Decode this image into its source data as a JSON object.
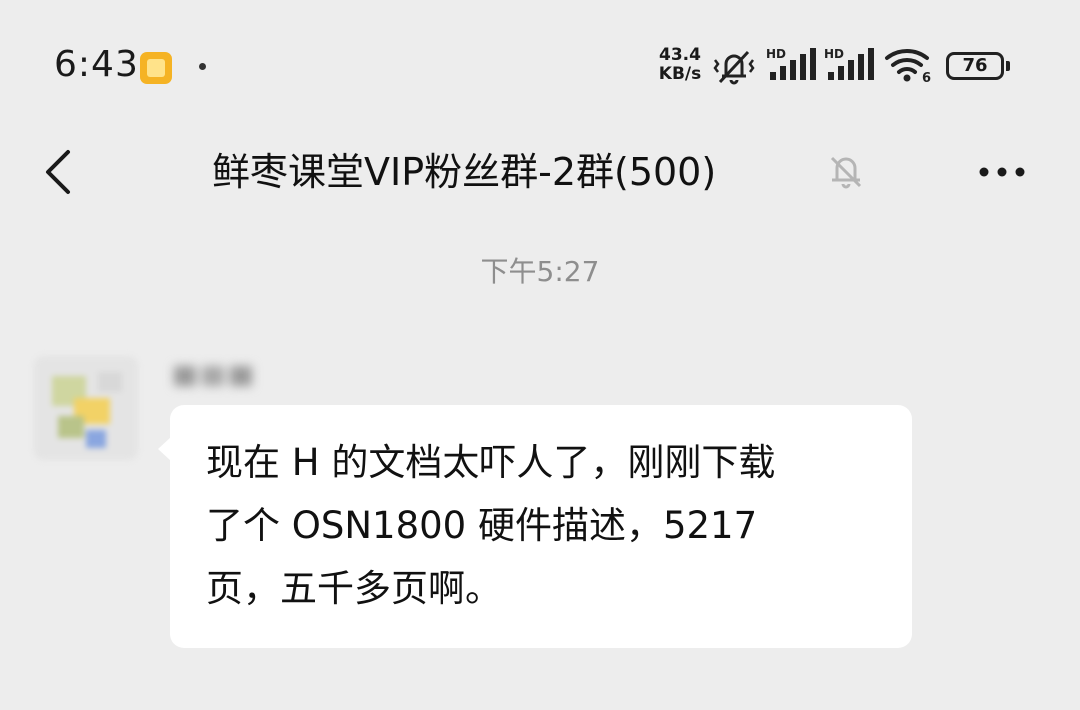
{
  "status_bar": {
    "time": "6:43",
    "net_speed_value": "43.4",
    "net_speed_unit": "KB/s",
    "signal1_label": "HD",
    "signal2_label": "HD",
    "wifi_label": "6",
    "battery": "76",
    "icons": [
      "app-badge-icon",
      "mute-vibrate-icon",
      "signal-icon",
      "signal-icon",
      "wifi-icon",
      "battery-icon"
    ]
  },
  "header": {
    "title": "鲜枣课堂VIP粉丝群-2群(500)",
    "icons": [
      "back-arrow-icon",
      "bell-muted-icon",
      "more-dots-icon"
    ]
  },
  "messages": {
    "timestamp": "下午5:27",
    "items": [
      {
        "lines": [
          "现在 H 的文档太吓人了，刚刚下载",
          "了个 OSN1800 硬件描述，5217",
          "页，五千多页啊。"
        ]
      }
    ]
  },
  "colors": {
    "background": "#ededed",
    "bubble": "#ffffff",
    "timestamp_text": "#8e8e8e",
    "badge_orange": "#f5b324"
  }
}
